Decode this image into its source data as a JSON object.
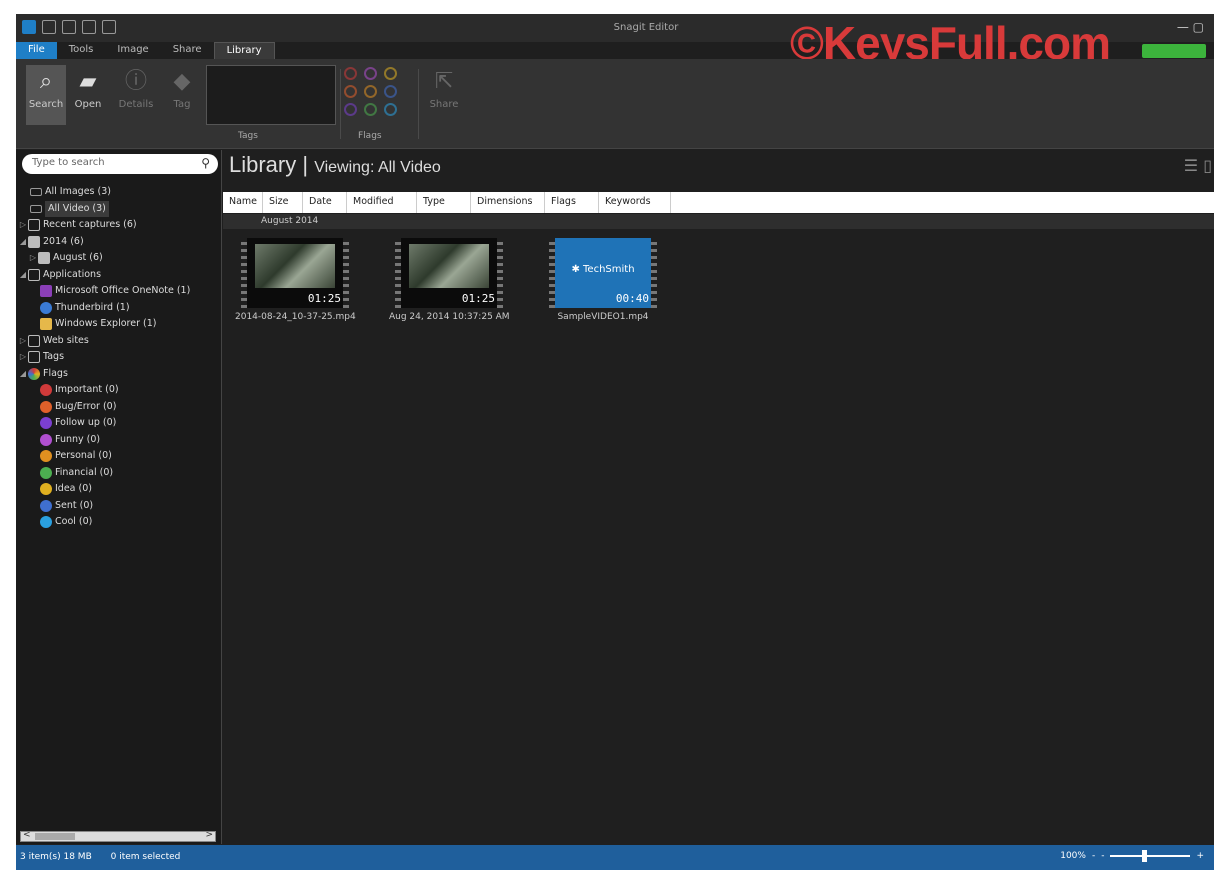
{
  "window": {
    "title": "Snagit Editor",
    "watermark": "©KeysFull.com"
  },
  "tabs": [
    "File",
    "Tools",
    "Image",
    "Share",
    "Library"
  ],
  "ribbon": {
    "search_label": "Search",
    "open_label": "Open",
    "details_label": "Details",
    "tag_label": "Tag",
    "share_label": "Share",
    "group_tags": "Tags",
    "group_flags": "Flags"
  },
  "left": {
    "search_placeholder": "Type to search",
    "tree": [
      {
        "label": "All Images (3)"
      },
      {
        "label": "All Video (3)"
      },
      {
        "label": "Recent captures (6)"
      },
      {
        "label": "2014 (6)"
      },
      {
        "label": "August (6)"
      },
      {
        "label": "Applications"
      },
      {
        "label": "Microsoft Office OneNote (1)"
      },
      {
        "label": "Thunderbird (1)"
      },
      {
        "label": "Windows Explorer (1)"
      },
      {
        "label": "Web sites"
      },
      {
        "label": "Tags"
      },
      {
        "label": "Flags"
      },
      {
        "label": "Important (0)"
      },
      {
        "label": "Bug/Error (0)"
      },
      {
        "label": "Follow up (0)"
      },
      {
        "label": "Funny (0)"
      },
      {
        "label": "Personal (0)"
      },
      {
        "label": "Financial (0)"
      },
      {
        "label": "Idea (0)"
      },
      {
        "label": "Sent (0)"
      },
      {
        "label": "Cool (0)"
      }
    ]
  },
  "main": {
    "title": "Library",
    "viewing": "Viewing: All Video",
    "columns": [
      "Name",
      "Size",
      "Date",
      "Modified",
      "Type",
      "Dimensions",
      "Flags",
      "Keywords"
    ],
    "group": "August 2014",
    "items": [
      {
        "name": "2014-08-24_10-37-25.mp4",
        "duration": "01:25"
      },
      {
        "name": "Aug 24, 2014 10:37:25 AM",
        "duration": "01:25"
      },
      {
        "name": "SampleVIDEO1.mp4",
        "duration": "00:40",
        "brand": "TechSmith"
      }
    ]
  },
  "status": {
    "items": "3 item(s) 18 MB",
    "selected": "0 item selected",
    "zoom": "100%",
    "minus": "-",
    "plus": "+"
  },
  "colors": {
    "accent": "#1f7fc7",
    "statusbar": "#1f5f9c",
    "watermark": "#d83a3a",
    "flag_important": "#d03a3a",
    "flag_bug": "#e0602a",
    "flag_follow": "#7b3fd0",
    "flag_funny": "#b04fd0",
    "flag_personal": "#e09020",
    "flag_financial": "#4caf50",
    "flag_idea": "#e0b020",
    "flag_sent": "#3f6fd0",
    "flag_cool": "#2aa0e0"
  }
}
